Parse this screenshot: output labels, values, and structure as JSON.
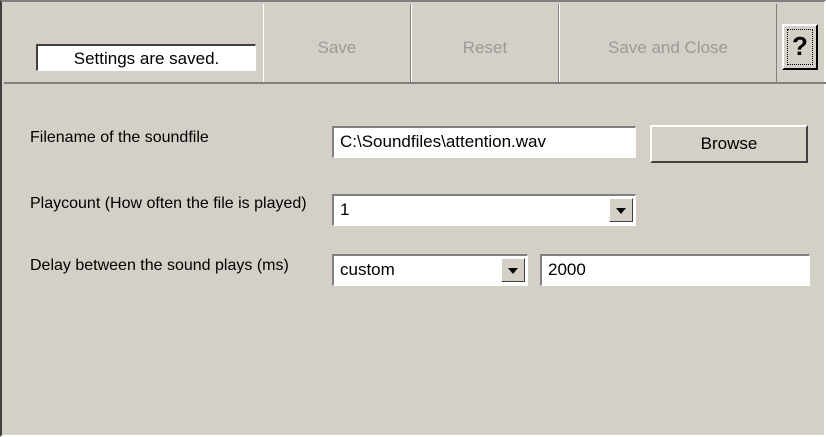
{
  "status": {
    "text": "Settings are saved."
  },
  "toolbar": {
    "save_label": "Save",
    "reset_label": "Reset",
    "save_close_label": "Save and Close",
    "help_label": "?"
  },
  "form": {
    "filename": {
      "label": "Filename of the soundfile",
      "value": "C:\\Soundfiles\\attention.wav",
      "browse_label": "Browse"
    },
    "playcount": {
      "label": "Playcount (How often the file is played)",
      "selected": "1"
    },
    "delay": {
      "label": "Delay between the sound plays (ms)",
      "mode_selected": "custom",
      "value": "2000"
    }
  },
  "icons": {
    "dropdown": "chevron-down-icon"
  }
}
